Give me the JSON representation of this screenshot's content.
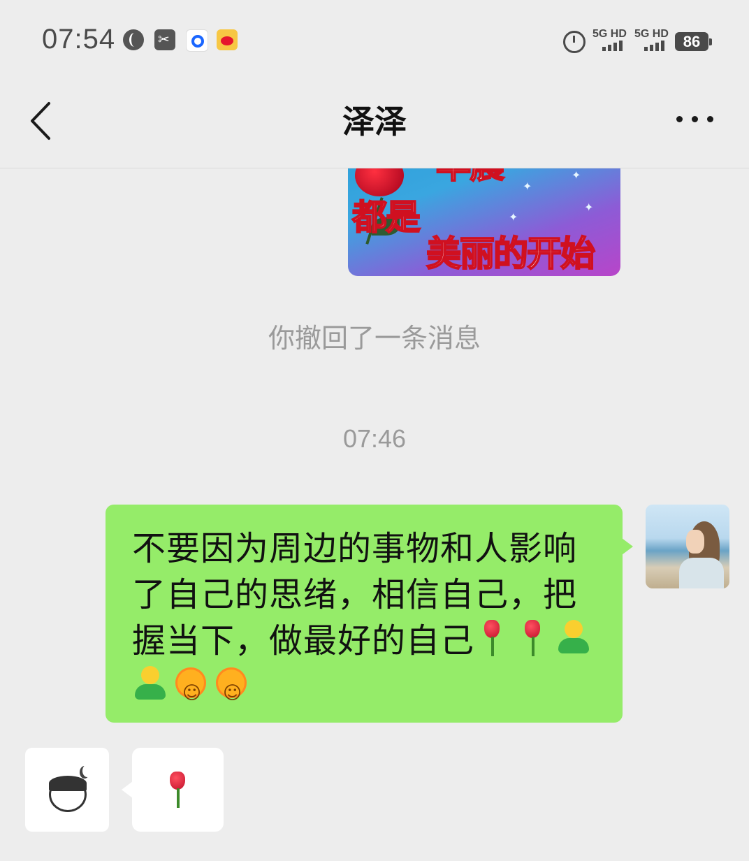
{
  "status_bar": {
    "time": "07:54",
    "network_1": "5G HD",
    "network_2": "5G HD",
    "battery": "86",
    "icons": [
      "globe-icon",
      "scissor-app-icon",
      "q-app-icon",
      "weibo-icon",
      "alarm-icon"
    ]
  },
  "nav": {
    "title": "泽泽",
    "back_icon": "chevron-left-icon",
    "more_icon": "more-dots-icon"
  },
  "chat": {
    "sticker": {
      "line1": "早晨",
      "line2": "都是",
      "line3": "美丽的开始"
    },
    "recall_notice": "你撤回了一条消息",
    "timestamp": "07:46",
    "outgoing_message": {
      "text": "不要因为周边的事物和人影响了自己的思绪，相信自己，把握当下，做最好的自己",
      "emojis": [
        "rose",
        "rose",
        "person",
        "person",
        "sun",
        "sun"
      ]
    },
    "incoming_message": {
      "emoji": "rose"
    }
  },
  "colors": {
    "background": "#ededed",
    "outgoing_bubble": "#95ec69",
    "incoming_bubble": "#ffffff",
    "muted_text": "#9a9a9a"
  }
}
